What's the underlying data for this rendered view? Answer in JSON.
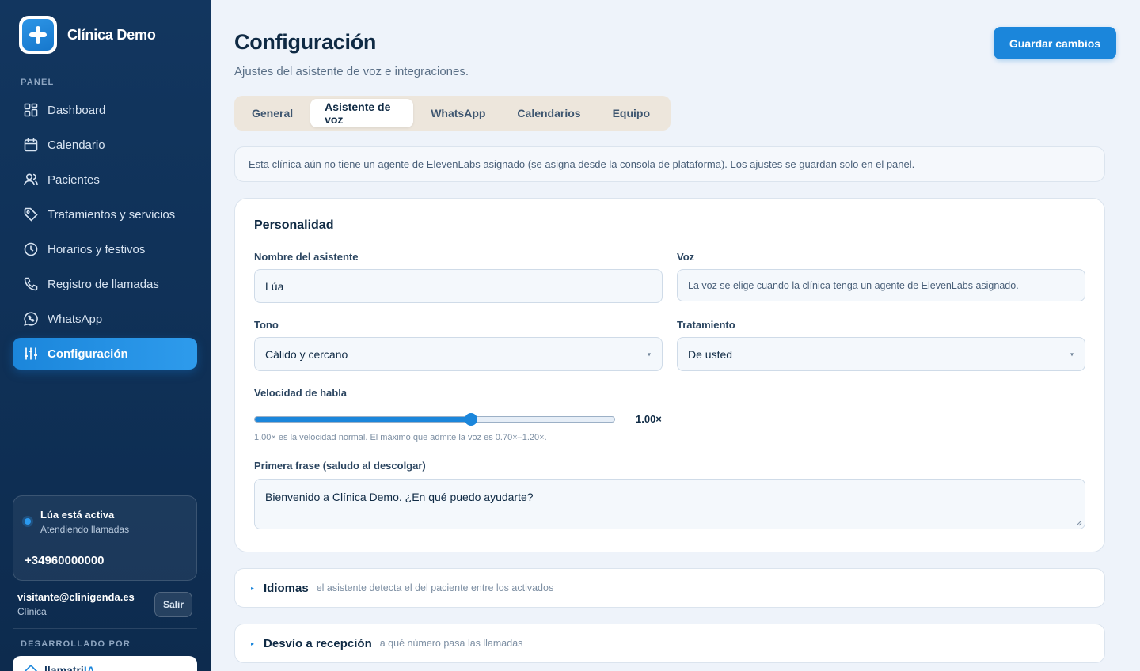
{
  "app": {
    "name": "Clínica Demo"
  },
  "sidebar": {
    "section_label": "PANEL",
    "items": [
      {
        "label": "Dashboard",
        "icon": "dashboard-icon"
      },
      {
        "label": "Calendario",
        "icon": "calendar-icon"
      },
      {
        "label": "Pacientes",
        "icon": "users-icon"
      },
      {
        "label": "Tratamientos y servicios",
        "icon": "tag-icon"
      },
      {
        "label": "Horarios y festivos",
        "icon": "clock-icon"
      },
      {
        "label": "Registro de llamadas",
        "icon": "phone-icon"
      },
      {
        "label": "WhatsApp",
        "icon": "whatsapp-icon"
      },
      {
        "label": "Configuración",
        "icon": "sliders-icon",
        "active": true
      }
    ],
    "status": {
      "title": "Lúa está activa",
      "subtitle": "Atendiendo llamadas",
      "phone": "+34960000000"
    },
    "user": {
      "email": "visitante@clinigenda.es",
      "role": "Clínica",
      "logout_label": "Salir"
    },
    "developed_by_label": "DESARROLLADO POR",
    "developer": {
      "name_prefix": "llamatri",
      "name_suffix": "IA"
    }
  },
  "header": {
    "title": "Configuración",
    "subtitle": "Ajustes del asistente de voz e integraciones.",
    "save_label": "Guardar cambios"
  },
  "tabs": [
    {
      "label": "General"
    },
    {
      "label": "Asistente de voz",
      "active": true
    },
    {
      "label": "WhatsApp"
    },
    {
      "label": "Calendarios"
    },
    {
      "label": "Equipo"
    }
  ],
  "notice": "Esta clínica aún no tiene un agente de ElevenLabs asignado (se asigna desde la consola de plataforma). Los ajustes se guardan solo en el panel.",
  "personality": {
    "title": "Personalidad",
    "name_label": "Nombre del asistente",
    "name_value": "Lúa",
    "voice_label": "Voz",
    "voice_value": "La voz se elige cuando la clínica tenga un agente de ElevenLabs asignado.",
    "tone_label": "Tono",
    "tone_value": "Cálido y cercano",
    "treatment_label": "Tratamiento",
    "treatment_value": "De usted",
    "speed_label": "Velocidad de habla",
    "speed_value": "1.00×",
    "speed_fraction": 0.6,
    "speed_hint": "1.00× es la velocidad normal. El máximo que admite la voz es 0.70×–1.20×.",
    "greeting_label": "Primera frase (saludo al descolgar)",
    "greeting_value": "Bienvenido a Clínica Demo. ¿En qué puedo ayudarte?"
  },
  "sections": [
    {
      "title": "Idiomas",
      "subtitle": "el asistente detecta el del paciente entre los activados"
    },
    {
      "title": "Desvío a recepción",
      "subtitle": "a qué número pasa las llamadas"
    }
  ],
  "colors": {
    "accent": "#1b86db",
    "sidebar": "#12365f",
    "background": "#eef3fa"
  }
}
